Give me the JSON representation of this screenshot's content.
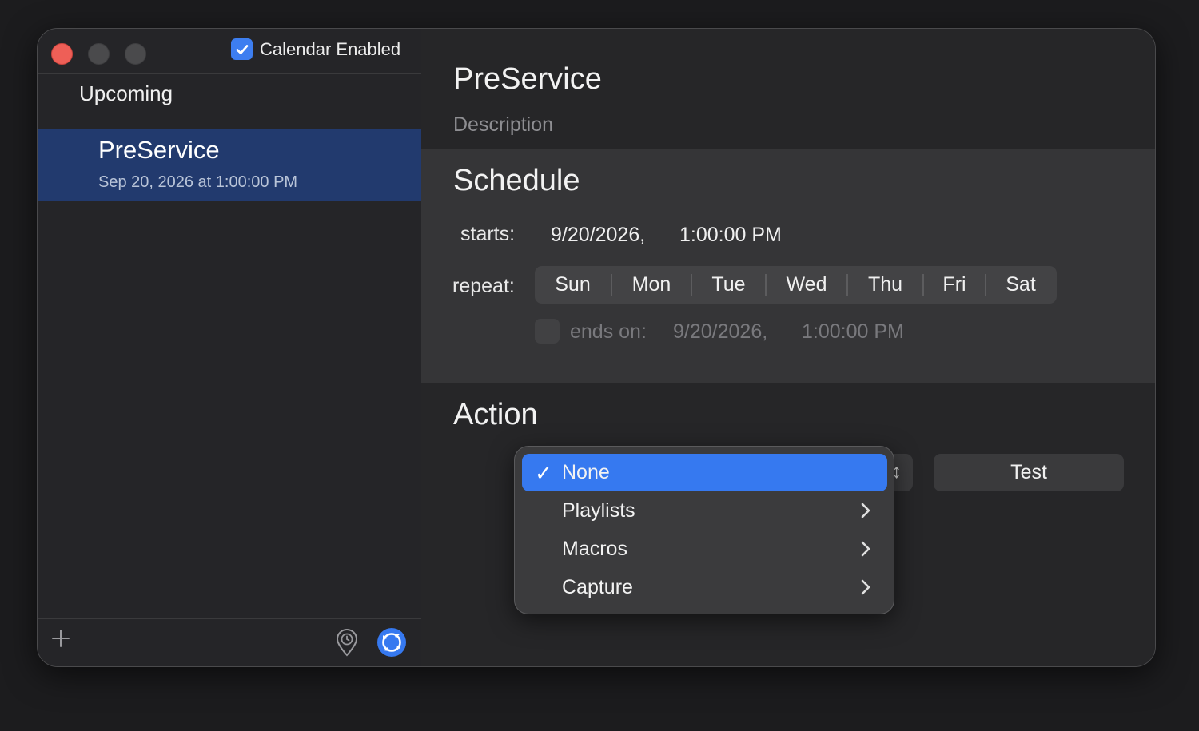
{
  "sidebar": {
    "calendar_enabled": {
      "label": "Calendar Enabled",
      "checked": true
    },
    "section_header": "Upcoming",
    "events": [
      {
        "title": "PreService",
        "subtitle": "Sep 20, 2026 at 1:00:00 PM",
        "selected": true
      }
    ],
    "footer": {
      "add_icon": "plus-icon",
      "pin_icon": "location-clock-icon",
      "sync_icon": "sync-icon"
    }
  },
  "event": {
    "title": "PreService",
    "description_placeholder": "Description"
  },
  "schedule": {
    "heading": "Schedule",
    "starts_label": "starts:",
    "starts_date": "9/20/2026,",
    "starts_time": "1:00:00 PM",
    "repeat_label": "repeat:",
    "days": [
      "Sun",
      "Mon",
      "Tue",
      "Wed",
      "Thu",
      "Fri",
      "Sat"
    ],
    "ends_label": "ends on:",
    "ends_date": "9/20/2026,",
    "ends_time": "1:00:00 PM",
    "ends_enabled": false
  },
  "action": {
    "heading": "Action",
    "test_button": "Test",
    "menu": {
      "items": [
        {
          "label": "None",
          "checked": true,
          "submenu": false
        },
        {
          "label": "Playlists",
          "checked": false,
          "submenu": true
        },
        {
          "label": "Macros",
          "checked": false,
          "submenu": true
        },
        {
          "label": "Capture",
          "checked": false,
          "submenu": true
        }
      ],
      "check_glyph": "✓"
    }
  },
  "colors": {
    "accent": "#3679f0",
    "selection": "#223a6e",
    "close": "#ee5f57"
  }
}
